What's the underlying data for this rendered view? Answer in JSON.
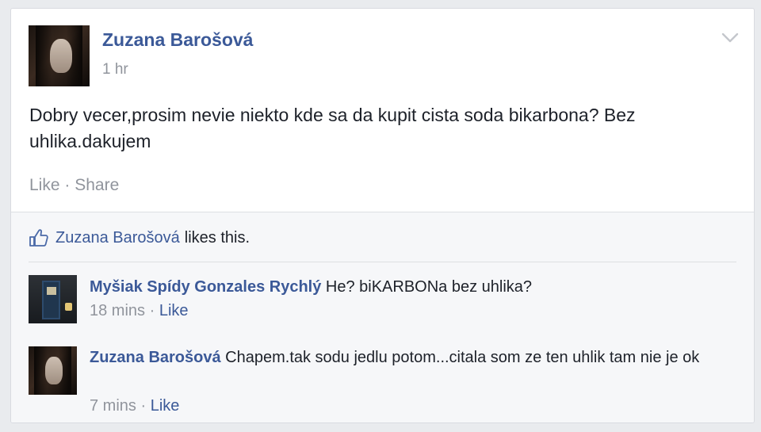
{
  "post": {
    "author": "Zuzana Barošová",
    "time": "1 hr",
    "text": "Dobry vecer,prosim nevie niekto kde sa da kupit cista soda bikarbona? Bez uhlika.dakujem",
    "actions": {
      "like": "Like",
      "separator": "·",
      "share": "Share"
    }
  },
  "likes": {
    "name": "Zuzana Barošová",
    "suffix": "likes this."
  },
  "comments": [
    {
      "author": "Myšiak Spídy Gonzales Rychlý",
      "text": "He? biKARBONa bez uhlika?",
      "time": "18 mins",
      "separator": "·",
      "like": "Like"
    },
    {
      "author": "Zuzana Barošová",
      "text": "Chapem.tak sodu jedlu potom...citala som ze ten uhlik tam nie je ok",
      "time": "7 mins",
      "separator": "·",
      "like": "Like"
    }
  ],
  "icons": {
    "menu": "chevron-down-icon",
    "like": "thumbs-up-icon"
  },
  "colors": {
    "link": "#3b5998",
    "meta": "#90949c",
    "background": "#e9ebee",
    "ufi_background": "#f6f7f9"
  }
}
